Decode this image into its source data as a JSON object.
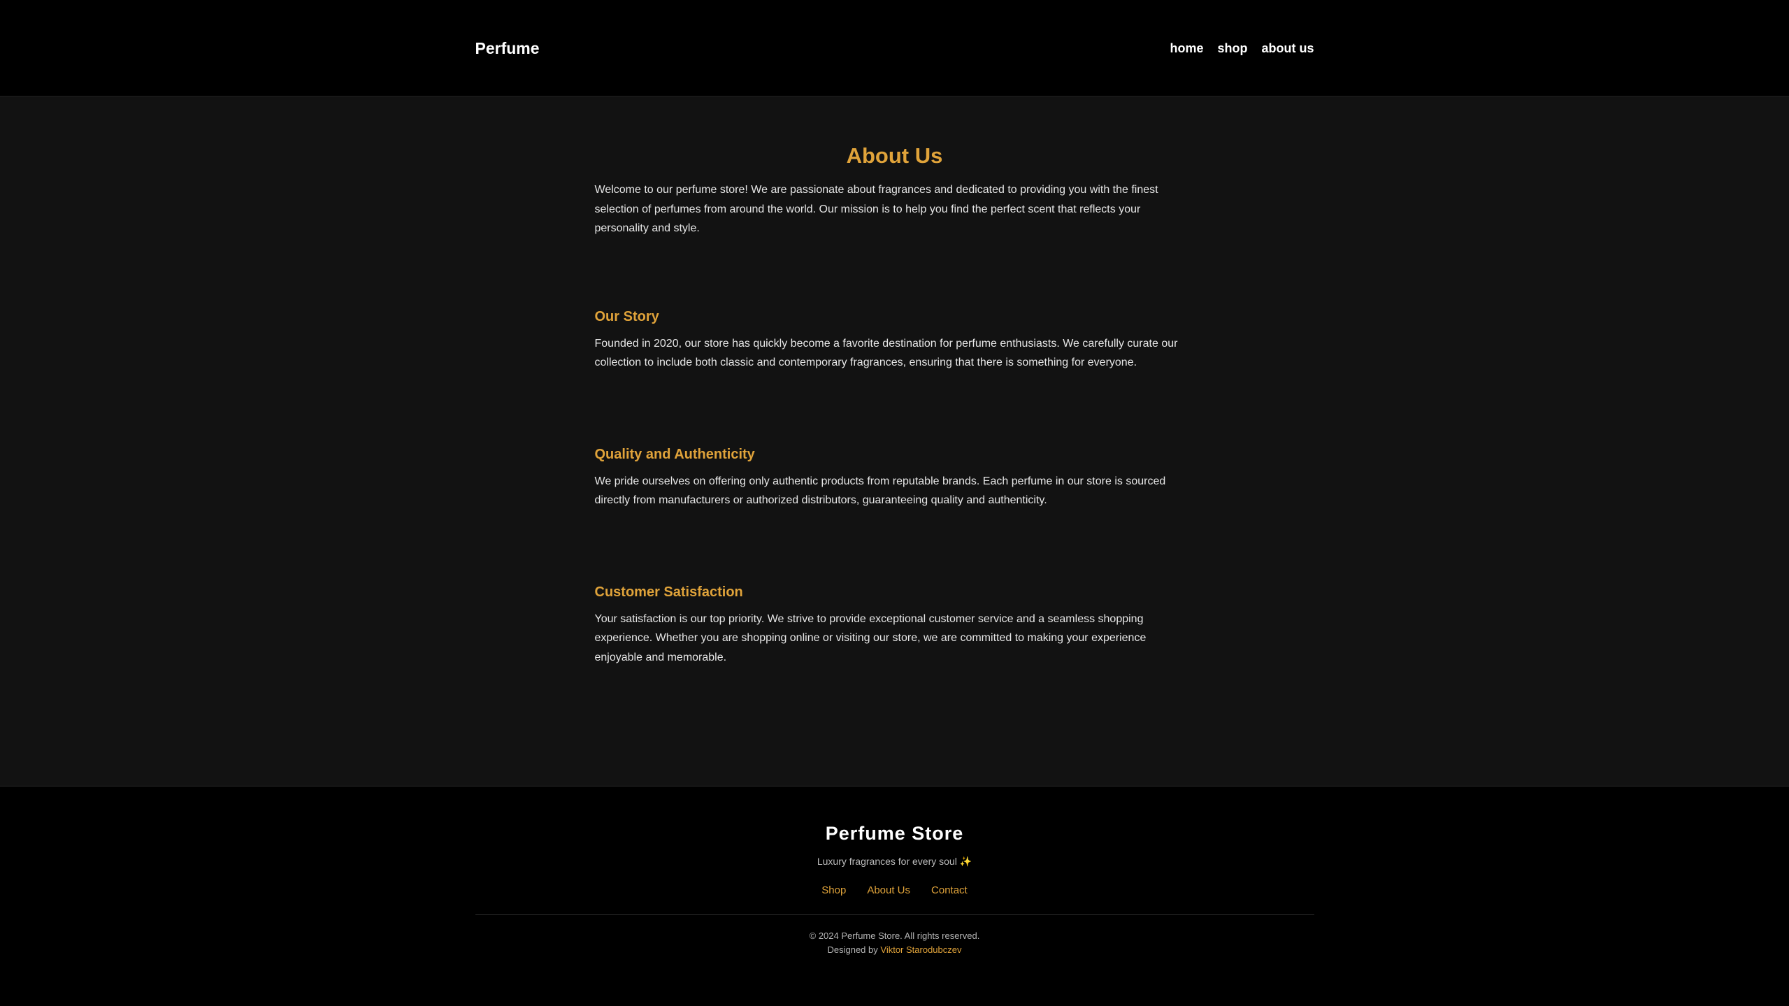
{
  "header": {
    "brand": "Perfume",
    "nav": [
      "home",
      "shop",
      "about us"
    ]
  },
  "main": {
    "title": "About Us",
    "intro": "Welcome to our perfume store! We are passionate about fragrances and dedicated to providing you with the finest selection of perfumes from around the world. Our mission is to help you find the perfect scent that reflects your personality and style.",
    "sections": [
      {
        "heading": "Our Story",
        "text": "Founded in 2020, our store has quickly become a favorite destination for perfume enthusiasts. We carefully curate our collection to include both classic and contemporary fragrances, ensuring that there is something for everyone."
      },
      {
        "heading": "Quality and Authenticity",
        "text": "We pride ourselves on offering only authentic products from reputable brands. Each perfume in our store is sourced directly from manufacturers or authorized distributors, guaranteeing quality and authenticity."
      },
      {
        "heading": "Customer Satisfaction",
        "text": "Your satisfaction is our top priority. We strive to provide exceptional customer service and a seamless shopping experience. Whether you are shopping online or visiting our store, we are committed to making your experience enjoyable and memorable."
      }
    ]
  },
  "footer": {
    "title": "Perfume Store",
    "tagline": "Luxury fragrances for every soul",
    "tagline_icon": "✨",
    "links": [
      "Shop",
      "About Us",
      "Contact"
    ],
    "copyright": "© 2024 Perfume Store. All rights reserved.",
    "designed_prefix": "Designed by",
    "designer": "Viktor Starodubczev"
  },
  "colors": {
    "accent": "#e0a33a",
    "background": "#121212",
    "header_footer": "#000000"
  }
}
